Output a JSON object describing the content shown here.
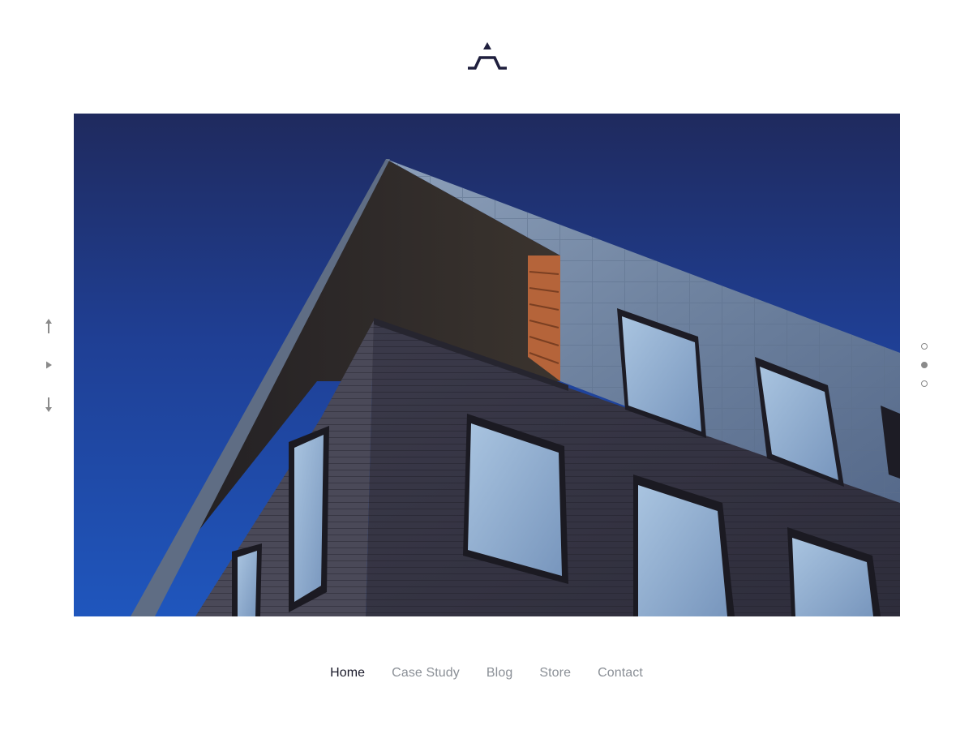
{
  "brand": {
    "logo_icon": "abstract-a-logo-icon",
    "logo_color": "#1f1f3d"
  },
  "hero": {
    "image": "modern-brick-building-corner-against-blue-sky",
    "sky_color_top": "#1f2a5e",
    "sky_color_bottom": "#1f56bd"
  },
  "side_controls": {
    "up_icon": "arrow-up-icon",
    "play_icon": "play-icon",
    "down_icon": "arrow-down-icon",
    "icon_color": "#8a8a8a"
  },
  "slider": {
    "slide_count": 3,
    "active_index": 1
  },
  "nav": {
    "items": [
      {
        "label": "Home",
        "active": true
      },
      {
        "label": "Case Study",
        "active": false
      },
      {
        "label": "Blog",
        "active": false
      },
      {
        "label": "Store",
        "active": false
      },
      {
        "label": "Contact",
        "active": false
      }
    ],
    "active_color": "#1a1a2a",
    "inactive_color": "#8a8f96"
  }
}
